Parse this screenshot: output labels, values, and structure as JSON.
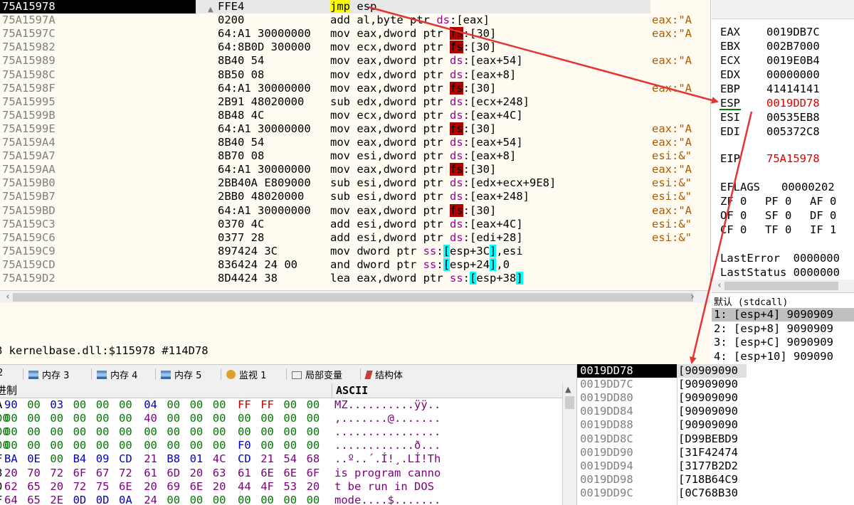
{
  "disasm": {
    "rows": [
      {
        "addr": "75A15978",
        "bytes": "FFE4",
        "mnem": "jmp",
        "ops": [
          {
            "t": "esp",
            "c": "reg"
          }
        ],
        "cmt": ""
      },
      {
        "addr": "75A1597A",
        "bytes": "0200",
        "mnem": "add",
        "ops": [
          {
            "t": "al,byte ptr ",
            "c": "kw"
          },
          {
            "t": "ds",
            "c": "seg"
          },
          {
            "t": ":[eax]",
            "c": "kw"
          }
        ],
        "cmt": "eax:\"A"
      },
      {
        "addr": "75A1597C",
        "bytes": "64:A1 30000000",
        "mnem": "mov",
        "ops": [
          {
            "t": "eax,dword ptr ",
            "c": "kw"
          },
          {
            "t": "fs",
            "c": "fs"
          },
          {
            "t": ":[30]",
            "c": "kw"
          }
        ],
        "cmt": "eax:\"A"
      },
      {
        "addr": "75A15982",
        "bytes": "64:8B0D 300000",
        "mnem": "mov",
        "ops": [
          {
            "t": "ecx,dword ptr ",
            "c": "kw"
          },
          {
            "t": "fs",
            "c": "fs"
          },
          {
            "t": ":[30]",
            "c": "kw"
          }
        ],
        "cmt": ""
      },
      {
        "addr": "75A15989",
        "bytes": "8B40 54",
        "mnem": "mov",
        "ops": [
          {
            "t": "eax,dword ptr ",
            "c": "kw"
          },
          {
            "t": "ds",
            "c": "seg"
          },
          {
            "t": ":[eax+54]",
            "c": "kw"
          }
        ],
        "cmt": "eax:\"A"
      },
      {
        "addr": "75A1598C",
        "bytes": "8B50 08",
        "mnem": "mov",
        "ops": [
          {
            "t": "edx,dword ptr ",
            "c": "kw"
          },
          {
            "t": "ds",
            "c": "seg"
          },
          {
            "t": ":[eax+8]",
            "c": "kw"
          }
        ],
        "cmt": ""
      },
      {
        "addr": "75A1598F",
        "bytes": "64:A1 30000000",
        "mnem": "mov",
        "ops": [
          {
            "t": "eax,dword ptr ",
            "c": "kw"
          },
          {
            "t": "fs",
            "c": "fs"
          },
          {
            "t": ":[30]",
            "c": "kw"
          }
        ],
        "cmt": "eax:\"A"
      },
      {
        "addr": "75A15995",
        "bytes": "2B91 48020000",
        "mnem": "sub",
        "ops": [
          {
            "t": "edx,dword ptr ",
            "c": "kw"
          },
          {
            "t": "ds",
            "c": "seg"
          },
          {
            "t": ":[ecx+248]",
            "c": "kw"
          }
        ],
        "cmt": ""
      },
      {
        "addr": "75A1599B",
        "bytes": "8B48 4C",
        "mnem": "mov",
        "ops": [
          {
            "t": "ecx,dword ptr ",
            "c": "kw"
          },
          {
            "t": "ds",
            "c": "seg"
          },
          {
            "t": ":[eax+4C]",
            "c": "kw"
          }
        ],
        "cmt": ""
      },
      {
        "addr": "75A1599E",
        "bytes": "64:A1 30000000",
        "mnem": "mov",
        "ops": [
          {
            "t": "eax,dword ptr ",
            "c": "kw"
          },
          {
            "t": "fs",
            "c": "fs"
          },
          {
            "t": ":[30]",
            "c": "kw"
          }
        ],
        "cmt": "eax:\"A"
      },
      {
        "addr": "75A159A4",
        "bytes": "8B40 54",
        "mnem": "mov",
        "ops": [
          {
            "t": "eax,dword ptr ",
            "c": "kw"
          },
          {
            "t": "ds",
            "c": "seg"
          },
          {
            "t": ":[eax+54]",
            "c": "kw"
          }
        ],
        "cmt": "eax:\"A"
      },
      {
        "addr": "75A159A7",
        "bytes": "8B70 08",
        "mnem": "mov",
        "ops": [
          {
            "t": "esi,dword ptr ",
            "c": "kw"
          },
          {
            "t": "ds",
            "c": "seg"
          },
          {
            "t": ":[eax+8]",
            "c": "kw"
          }
        ],
        "cmt": "esi:&\""
      },
      {
        "addr": "75A159AA",
        "bytes": "64:A1 30000000",
        "mnem": "mov",
        "ops": [
          {
            "t": "eax,dword ptr ",
            "c": "kw"
          },
          {
            "t": "fs",
            "c": "fs"
          },
          {
            "t": ":[30]",
            "c": "kw"
          }
        ],
        "cmt": "eax:\"A"
      },
      {
        "addr": "75A159B0",
        "bytes": "2BB40A E809000",
        "mnem": "sub",
        "ops": [
          {
            "t": "esi,dword ptr ",
            "c": "kw"
          },
          {
            "t": "ds",
            "c": "seg"
          },
          {
            "t": ":[edx+ecx+9E8]",
            "c": "kw"
          }
        ],
        "cmt": "esi:&\""
      },
      {
        "addr": "75A159B7",
        "bytes": "2BB0 48020000",
        "mnem": "sub",
        "ops": [
          {
            "t": "esi,dword ptr ",
            "c": "kw"
          },
          {
            "t": "ds",
            "c": "seg"
          },
          {
            "t": ":[eax+248]",
            "c": "kw"
          }
        ],
        "cmt": "esi:&\""
      },
      {
        "addr": "75A159BD",
        "bytes": "64:A1 30000000",
        "mnem": "mov",
        "ops": [
          {
            "t": "eax,dword ptr ",
            "c": "kw"
          },
          {
            "t": "fs",
            "c": "fs"
          },
          {
            "t": ":[30]",
            "c": "kw"
          }
        ],
        "cmt": "eax:\"A"
      },
      {
        "addr": "75A159C3",
        "bytes": "0370 4C",
        "mnem": "add",
        "ops": [
          {
            "t": "esi,dword ptr ",
            "c": "kw"
          },
          {
            "t": "ds",
            "c": "seg"
          },
          {
            "t": ":[eax+4C]",
            "c": "kw"
          }
        ],
        "cmt": "esi:&\""
      },
      {
        "addr": "75A159C6",
        "bytes": "0377 28",
        "mnem": "add",
        "ops": [
          {
            "t": "esi,dword ptr ",
            "c": "kw"
          },
          {
            "t": "ds",
            "c": "seg"
          },
          {
            "t": ":[edi+28]",
            "c": "kw"
          }
        ],
        "cmt": "esi:&\""
      },
      {
        "addr": "75A159C9",
        "bytes": "897424 3C",
        "mnem": "mov",
        "ops": [
          {
            "t": "dword ptr ",
            "c": "kw"
          },
          {
            "t": "ss",
            "c": "seg"
          },
          {
            "t": ":",
            "c": "kw"
          },
          {
            "t": "[",
            "c": "cyan"
          },
          {
            "t": "esp+3C",
            "c": "kw"
          },
          {
            "t": "]",
            "c": "cyan"
          },
          {
            "t": ",esi",
            "c": "kw"
          }
        ],
        "cmt": ""
      },
      {
        "addr": "75A159CD",
        "bytes": "836424 24 00",
        "mnem": "and",
        "ops": [
          {
            "t": "dword ptr ",
            "c": "kw"
          },
          {
            "t": "ss",
            "c": "seg"
          },
          {
            "t": ":",
            "c": "kw"
          },
          {
            "t": "[",
            "c": "cyan"
          },
          {
            "t": "esp+24",
            "c": "kw"
          },
          {
            "t": "]",
            "c": "cyan"
          },
          {
            "t": ",0",
            "c": "kw"
          }
        ],
        "cmt": ""
      },
      {
        "addr": "75A159D2",
        "bytes": "8D4424 38",
        "mnem": "lea",
        "ops": [
          {
            "t": "eax,dword ptr ",
            "c": "kw"
          },
          {
            "t": "ss",
            "c": "seg"
          },
          {
            "t": ":",
            "c": "kw"
          },
          {
            "t": "[",
            "c": "cyan"
          },
          {
            "t": "esp+38",
            "c": "kw"
          },
          {
            "t": "]",
            "c": "cyan"
          }
        ],
        "cmt": ""
      }
    ]
  },
  "registers": [
    {
      "name": "EAX",
      "value": "0019DB7C",
      "red": false
    },
    {
      "name": "EBX",
      "value": "002B7000",
      "red": false
    },
    {
      "name": "ECX",
      "value": "0019E0B4",
      "red": false
    },
    {
      "name": "EDX",
      "value": "00000000",
      "red": false
    },
    {
      "name": "EBP",
      "value": "41414141",
      "red": false
    },
    {
      "name": "ESP",
      "value": "0019DD78",
      "red": true
    },
    {
      "name": "ESI",
      "value": "00535EB8",
      "red": false
    },
    {
      "name": "EDI",
      "value": "005372C8",
      "red": false
    }
  ],
  "eip": {
    "name": "EIP",
    "value": "75A15978"
  },
  "eflags": {
    "name": "EFLAGS",
    "value": "00000202"
  },
  "flags": [
    [
      "ZF 0",
      "PF 0",
      "AF 0"
    ],
    [
      "OF 0",
      "SF 0",
      "DF 0"
    ],
    [
      "CF 0",
      "TF 0",
      "IF 1"
    ]
  ],
  "last_error": "LastError  0000000",
  "last_status": "LastStatus 0000000",
  "args": {
    "title": "默认 (stdcall)",
    "rows": [
      "1: [esp+4] 9090909",
      "2: [esp+8] 9090909",
      "3: [esp+C] 9090909",
      "4: [esp+10] 909090"
    ]
  },
  "info_line": "8 kernelbase.dll:$115978 #114D78",
  "tabs": [
    "2",
    "内存 3",
    "内存 4",
    "内存 5",
    "监视 1",
    "局部变量",
    "结构体"
  ],
  "dump": {
    "hex_header": "进制",
    "ascii_header": "ASCII",
    "rows": [
      {
        "hex": [
          "A",
          "90",
          "00",
          "03",
          "00",
          "00",
          "00",
          "04",
          "00",
          "00",
          "00",
          "FF",
          "FF",
          "00",
          "00"
        ],
        "ascii": "MZ..........ÿÿ.."
      },
      {
        "hex": [
          "00",
          "00",
          "00",
          "00",
          "00",
          "00",
          "00",
          "40",
          "00",
          "00",
          "00",
          "00",
          "00",
          "00",
          "00"
        ],
        "ascii": ",.......@......."
      },
      {
        "hex": [
          "00",
          "00",
          "00",
          "00",
          "00",
          "00",
          "00",
          "00",
          "00",
          "00",
          "00",
          "00",
          "00",
          "00",
          "00"
        ],
        "ascii": "................"
      },
      {
        "hex": [
          "00",
          "00",
          "00",
          "00",
          "00",
          "00",
          "00",
          "00",
          "00",
          "00",
          "00",
          "F0",
          "00",
          "00",
          "00"
        ],
        "ascii": "............ð..."
      },
      {
        "hex": [
          "F",
          "BA",
          "0E",
          "00",
          "B4",
          "09",
          "CD",
          "21",
          "B8",
          "01",
          "4C",
          "CD",
          "21",
          "54",
          "68"
        ],
        "ascii": "..º..´.Í!¸.LÍ!Th"
      },
      {
        "hex": [
          "8",
          "20",
          "70",
          "72",
          "6F",
          "67",
          "72",
          "61",
          "6D",
          "20",
          "63",
          "61",
          "6E",
          "6E",
          "6F"
        ],
        "ascii": "is program canno"
      },
      {
        "hex": [
          "0",
          "62",
          "65",
          "20",
          "72",
          "75",
          "6E",
          "20",
          "69",
          "6E",
          "20",
          "44",
          "4F",
          "53",
          "20"
        ],
        "ascii": "t be run in DOS "
      },
      {
        "hex": [
          "F",
          "64",
          "65",
          "2E",
          "0D",
          "0D",
          "0A",
          "24",
          "00",
          "00",
          "00",
          "00",
          "00",
          "00",
          "00"
        ],
        "ascii": "mode....$......."
      }
    ]
  },
  "stack": [
    {
      "addr": "0019DD78",
      "val": "[90909090"
    },
    {
      "addr": "0019DD7C",
      "val": "[90909090"
    },
    {
      "addr": "0019DD80",
      "val": "[90909090"
    },
    {
      "addr": "0019DD84",
      "val": "[90909090"
    },
    {
      "addr": "0019DD88",
      "val": "[90909090"
    },
    {
      "addr": "0019DD8C",
      "val": "[D99BEBD9"
    },
    {
      "addr": "0019DD90",
      "val": "[31F42474"
    },
    {
      "addr": "0019DD94",
      "val": "[3177B2D2"
    },
    {
      "addr": "0019DD98",
      "val": "[718B64C9"
    },
    {
      "addr": "0019DD9C",
      "val": "[0C768B30"
    }
  ],
  "colors": {
    "annotation": "#e53333",
    "highlight_red": "#e00000",
    "fs_bg": "#b00000",
    "jmp_bg": "#ffff00",
    "bracket_bg": "#00ffff"
  }
}
